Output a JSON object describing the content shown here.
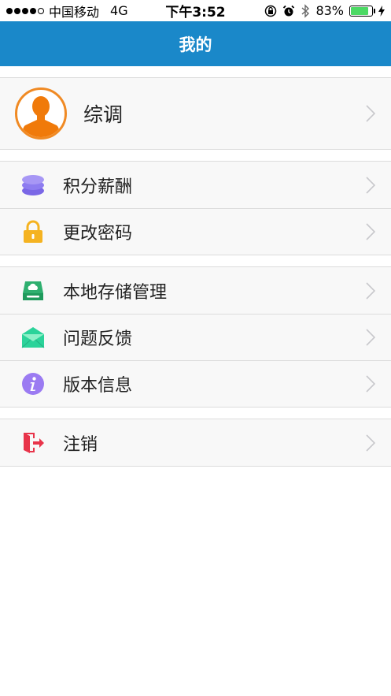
{
  "status_bar": {
    "carrier": "中国移动",
    "network": "4G",
    "time": "下午3:52",
    "battery": "83%",
    "battery_level": 0.83,
    "signal_bars_filled": 4,
    "signal_bars_total": 5,
    "icons": [
      "orientation-lock-icon",
      "alarm-icon",
      "bluetooth-icon",
      "battery-icon",
      "charging-icon"
    ]
  },
  "nav": {
    "title": "我的"
  },
  "profile": {
    "name": "综调",
    "avatar_icon": "avatar-icon"
  },
  "menu_groups": [
    {
      "items": [
        {
          "label": "积分薪酬",
          "icon": "coins-stack-icon",
          "color": "#8d7cf0"
        },
        {
          "label": "更改密码",
          "icon": "lock-icon",
          "color": "#f5b321"
        }
      ]
    },
    {
      "items": [
        {
          "label": "本地存储管理",
          "icon": "storage-icon",
          "color": "#2eaf6f"
        },
        {
          "label": "问题反馈",
          "icon": "envelope-icon",
          "color": "#2bd39a"
        },
        {
          "label": "版本信息",
          "icon": "info-icon",
          "color": "#9b7bf2"
        }
      ]
    },
    {
      "items": [
        {
          "label": "注销",
          "icon": "logout-icon",
          "color": "#e8344a"
        }
      ]
    }
  ],
  "colors": {
    "nav_background": "#1a88c9",
    "avatar_accent": "#f08a24",
    "chevron": "#c8c8cc",
    "row_background": "#f8f8f8"
  }
}
